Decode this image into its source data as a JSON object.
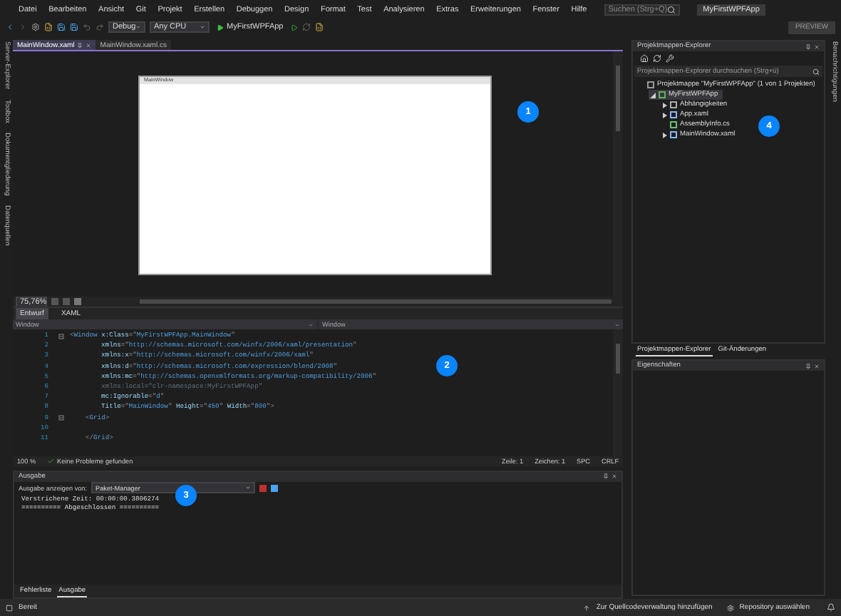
{
  "menu": [
    "Datei",
    "Bearbeiten",
    "Ansicht",
    "Git",
    "Projekt",
    "Erstellen",
    "Debuggen",
    "Design",
    "Format",
    "Test",
    "Analysieren",
    "Extras",
    "Erweiterungen",
    "Fenster",
    "Hilfe"
  ],
  "search": {
    "placeholder": "Suchen (Strg+Q)"
  },
  "solution_name": "MyFirstWPFApp",
  "toolbar": {
    "configuration": "Debug",
    "platform": "Any CPU",
    "run_target": "MyFirstWPFApp",
    "preview": "PREVIEW"
  },
  "side_tabs_left": [
    "Server-Explorer",
    "Toolbox",
    "Dokumentgliederung",
    "Datenquellen"
  ],
  "side_tabs_right": [
    "Benachrichtigungen"
  ],
  "editor_tabs": [
    {
      "label": "MainWindow.xaml",
      "selected": true
    },
    {
      "label": "MainWindow.xaml.cs",
      "selected": false
    }
  ],
  "designer": {
    "window_title": "MainWindow"
  },
  "zoom_bar": {
    "zoom": "75,76%"
  },
  "view_tabs": [
    {
      "label": "Entwurf",
      "selected": true
    },
    {
      "label": "XAML",
      "selected": false
    }
  ],
  "element_selectors": [
    "Window",
    "Window"
  ],
  "code_lines": [
    {
      "number": "1",
      "foldable": true,
      "tokens": [
        {
          "kind": "punct",
          "t": "<"
        },
        {
          "kind": "tag",
          "t": "Window"
        },
        {
          "kind": "attr",
          "t": " x:Class"
        },
        {
          "kind": "punct",
          "t": "=\""
        },
        {
          "kind": "value",
          "t": "MyFirstWPFApp.MainWindow"
        },
        {
          "kind": "punct",
          "t": "\""
        }
      ]
    },
    {
      "number": "2",
      "foldable": false,
      "tokens": [
        {
          "kind": "attr",
          "t": "        xmlns"
        },
        {
          "kind": "punct",
          "t": "=\""
        },
        {
          "kind": "value",
          "t": "http://schemas.microsoft.com/winfx/2006/xaml/presentation"
        },
        {
          "kind": "punct",
          "t": "\""
        }
      ]
    },
    {
      "number": "3",
      "foldable": false,
      "tokens": [
        {
          "kind": "attr",
          "t": "        xmlns:x"
        },
        {
          "kind": "punct",
          "t": "=\""
        },
        {
          "kind": "value",
          "t": "http://schemas.microsoft.com/winfx/2006/xaml"
        },
        {
          "kind": "punct",
          "t": "\""
        }
      ]
    },
    {
      "number": "4",
      "foldable": false,
      "tokens": [
        {
          "kind": "attr",
          "t": "        xmlns:d"
        },
        {
          "kind": "punct",
          "t": "=\""
        },
        {
          "kind": "value",
          "t": "http://schemas.microsoft.com/expression/blend/2008"
        },
        {
          "kind": "punct",
          "t": "\""
        }
      ]
    },
    {
      "number": "5",
      "foldable": false,
      "tokens": [
        {
          "kind": "attr",
          "t": "        xmlns:mc"
        },
        {
          "kind": "punct",
          "t": "=\""
        },
        {
          "kind": "value",
          "t": "http://schemas.openxmlformats.org/markup-compatibility/2006"
        },
        {
          "kind": "punct",
          "t": "\""
        }
      ]
    },
    {
      "number": "6",
      "foldable": false,
      "tokens": [
        {
          "kind": "dim",
          "t": "        xmlns:local=\"clr-namespace:MyFirstWPFApp\""
        }
      ]
    },
    {
      "number": "7",
      "foldable": false,
      "tokens": [
        {
          "kind": "attr",
          "t": "        mc:Ignorable"
        },
        {
          "kind": "punct",
          "t": "=\""
        },
        {
          "kind": "value",
          "t": "d"
        },
        {
          "kind": "punct",
          "t": "\""
        }
      ]
    },
    {
      "number": "8",
      "foldable": false,
      "tokens": [
        {
          "kind": "attr",
          "t": "        Title"
        },
        {
          "kind": "punct",
          "t": "=\""
        },
        {
          "kind": "value",
          "t": "MainWindow"
        },
        {
          "kind": "punct",
          "t": "\""
        },
        {
          "kind": "attr",
          "t": " Height"
        },
        {
          "kind": "punct",
          "t": "=\""
        },
        {
          "kind": "value",
          "t": "450"
        },
        {
          "kind": "punct",
          "t": "\""
        },
        {
          "kind": "attr",
          "t": " Width"
        },
        {
          "kind": "punct",
          "t": "=\""
        },
        {
          "kind": "value",
          "t": "800"
        },
        {
          "kind": "punct",
          "t": "\">"
        }
      ]
    },
    {
      "number": "9",
      "foldable": true,
      "tokens": [
        {
          "kind": "punct",
          "t": "    <"
        },
        {
          "kind": "tag",
          "t": "Grid"
        },
        {
          "kind": "punct",
          "t": ">"
        }
      ]
    },
    {
      "number": "10",
      "foldable": false
    },
    {
      "number": "11",
      "foldable": false,
      "tokens": [
        {
          "kind": "punct",
          "t": "    </"
        },
        {
          "kind": "tag",
          "t": "Grid"
        },
        {
          "kind": "punct",
          "t": ">"
        }
      ]
    }
  ],
  "code_status": {
    "zoom": "100 %",
    "message": "Keine Probleme gefunden",
    "line": "Zeile: 1",
    "char": "Zeichen: 1",
    "spacing": "SPC",
    "line_ending": "CRLF"
  },
  "output": {
    "title": "Ausgabe",
    "source_label": "Ausgabe anzeigen von:",
    "source": "Paket-Manager",
    "lines": [
      "Verstrichene Zeit: 00:00:00.3806274",
      "========== Abgeschlossen =========="
    ]
  },
  "bottom_tabs": [
    {
      "label": "Fehlerliste",
      "selected": false
    },
    {
      "label": "Ausgabe",
      "selected": true
    }
  ],
  "solution_explorer": {
    "title": "Projektmappen-Explorer",
    "search_placeholder": "Projektmappen-Explorer durchsuchen (Strg+ü)",
    "tree": [
      {
        "label": "Projektmappe \"MyFirstWPFApp\" (1 von 1 Projekten)",
        "kind": "solution",
        "selected": false,
        "children": [
          {
            "label": "MyFirstWPFApp",
            "kind": "project",
            "expanded": true,
            "selected": true,
            "children": [
              {
                "label": "Abhängigkeiten",
                "kind": "dependencies",
                "expanded": false,
                "selected": false
              },
              {
                "label": "App.xaml",
                "kind": "xaml",
                "expanded": false,
                "selected": false
              },
              {
                "label": "AssemblyInfo.cs",
                "kind": "csharp",
                "selected": false
              },
              {
                "label": "MainWindow.xaml",
                "kind": "xaml",
                "expanded": false,
                "selected": false
              }
            ]
          }
        ]
      }
    ]
  },
  "panel_tabs": [
    {
      "label": "Projektmappen-Explorer",
      "selected": true
    },
    {
      "label": "Git-Änderungen",
      "selected": false
    }
  ],
  "properties": {
    "title": "Eigenschaften"
  },
  "status_bar": {
    "state": "Bereit",
    "source_control": "Zur Quellcodeverwaltung hinzufügen",
    "repository": "Repository auswählen"
  },
  "callouts": [
    "1",
    "2",
    "3",
    "4"
  ]
}
